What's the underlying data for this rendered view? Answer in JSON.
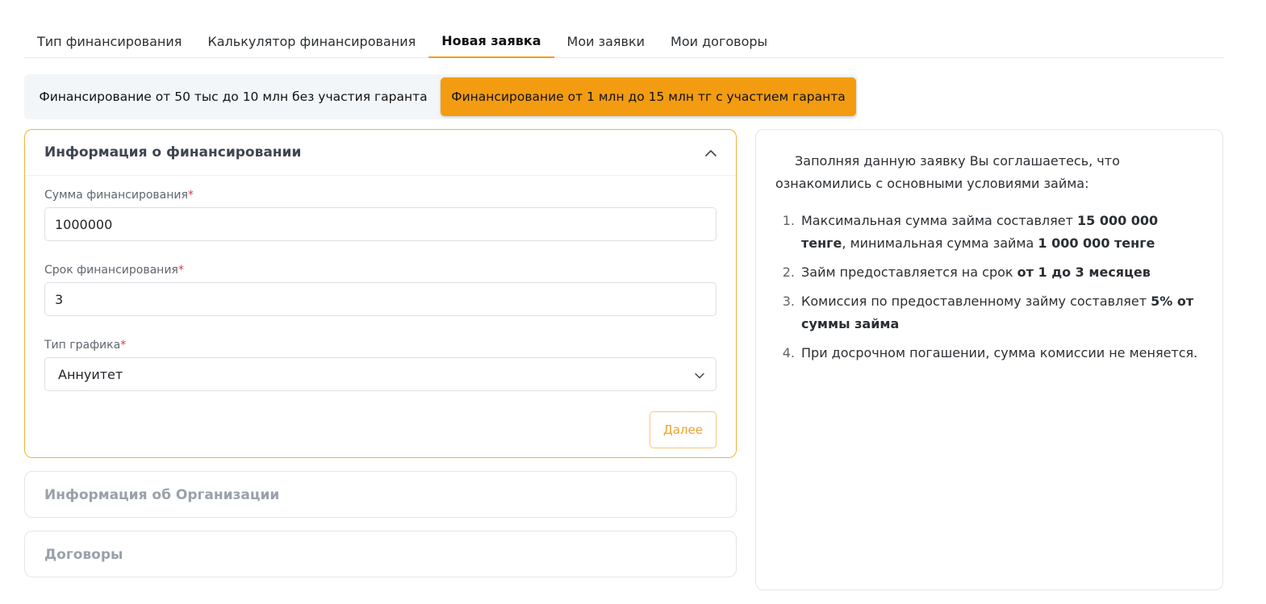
{
  "tabs": [
    {
      "label": "Тип финансирования",
      "active": false
    },
    {
      "label": "Калькулятор финансирования",
      "active": false
    },
    {
      "label": "Новая заявка",
      "active": true
    },
    {
      "label": "Мои заявки",
      "active": false
    },
    {
      "label": "Мои договоры",
      "active": false
    }
  ],
  "segments": {
    "option1": "Финансирование от 50 тыс до 10 млн без участия гаранта",
    "option2": "Финансирование от 1 млн до 15 млн тг с участием гаранта",
    "selected": "option2"
  },
  "accordion": {
    "section1": {
      "title": "Информация о финансировании",
      "expanded": true,
      "amount_label": "Сумма финансирования",
      "amount_value": "1000000",
      "term_label": "Срок финансирования",
      "term_value": "3",
      "schedule_label": "Тип графика",
      "schedule_value": "Аннуитет",
      "required_mark": "*",
      "next_label": "Далее"
    },
    "section2": {
      "title": "Информация об Организации",
      "expanded": false
    },
    "section3": {
      "title": "Договоры",
      "expanded": false
    }
  },
  "info": {
    "intro": "Заполняя данную заявку Вы соглашаетесь, что ознакомились с основными условиями займа:",
    "items": [
      {
        "num": "1.",
        "parts": [
          {
            "text": "Максимальная сумма займа составляет ",
            "bold": false
          },
          {
            "text": "15 000 000 тенге",
            "bold": true
          },
          {
            "text": ", минимальная сумма займа ",
            "bold": false
          },
          {
            "text": "1 000 000 тенге",
            "bold": true
          }
        ]
      },
      {
        "num": "2.",
        "parts": [
          {
            "text": "Займ предоставляется на срок ",
            "bold": false
          },
          {
            "text": "от 1 до 3 месяцев",
            "bold": true
          }
        ]
      },
      {
        "num": "3.",
        "parts": [
          {
            "text": "Комиссия по предоставленному займу составляет ",
            "bold": false
          },
          {
            "text": "5% от суммы займа",
            "bold": true
          }
        ]
      },
      {
        "num": "4.",
        "parts": [
          {
            "text": "При досрочном погашении, сумма комиссии не меняется.",
            "bold": false
          }
        ]
      }
    ]
  },
  "colors": {
    "accent": "#f39c12",
    "required": "#e0394a",
    "muted_title": "#9aa1ab"
  },
  "icons": {
    "collapse": "chevron-up-icon",
    "dropdown": "chevron-down-icon"
  }
}
